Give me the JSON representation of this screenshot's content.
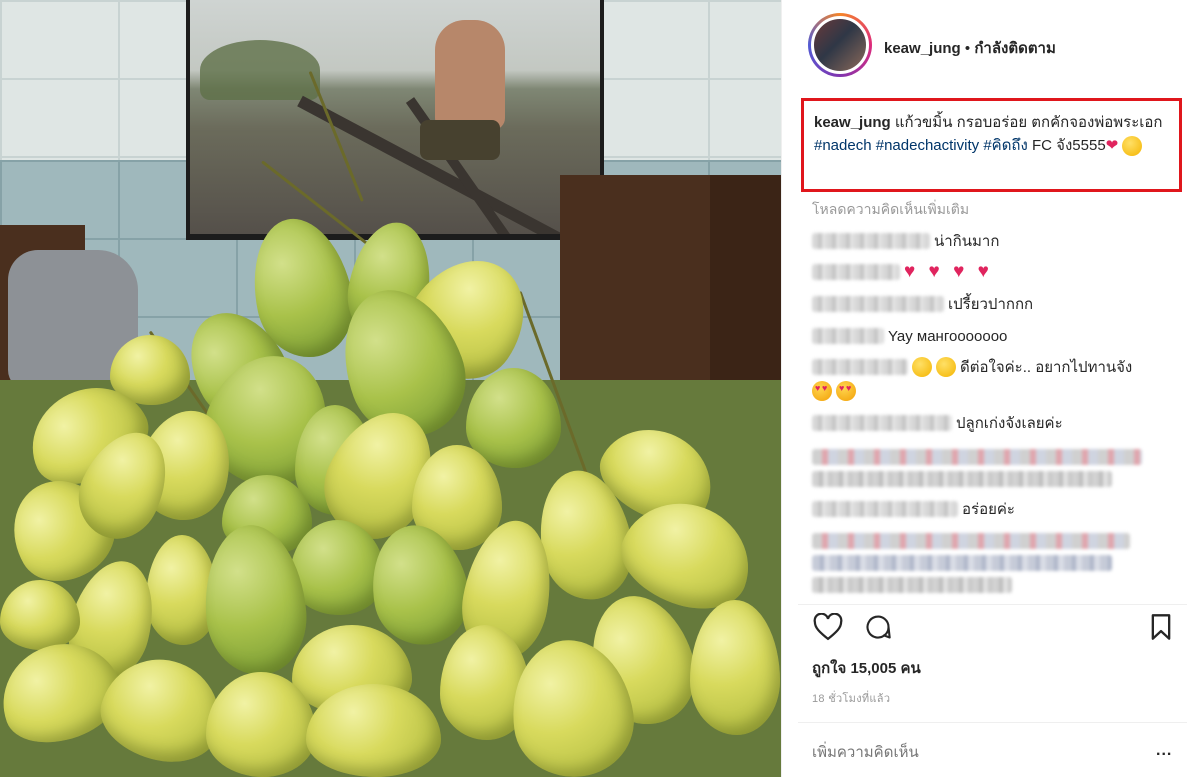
{
  "post": {
    "photo_alt_icon": "mango-photo",
    "header": {
      "username": "keaw_jung",
      "separator": "•",
      "follow_status": "กำลังติดตาม"
    },
    "caption": {
      "username": "keaw_jung",
      "text_1": "แก้วขมิ้น กรอบอร่อย ตกคักจองพ่อพระเอก",
      "hashtag_1": "#nadech",
      "hashtag_2": "#nadechactivity",
      "hashtag_3": "#คิดถึง",
      "text_2": "FC จัง5555",
      "emoji_icons": [
        "red-heart-icon",
        "blushing-face-icon"
      ]
    },
    "load_more_comments": "โหลดความคิดเห็นเพิ่มเติม",
    "comments": [
      {
        "text": "น่ากินมาก"
      },
      {
        "text": "♥ ♥ ♥ ♥"
      },
      {
        "text": "เปรี้ยวปากกก"
      },
      {
        "text": "Yay мангооооооо"
      },
      {
        "text": "ดีต่อใจค่ะ.. อยากไปทานจัง"
      },
      {
        "text": "ปลูกเก่งจังเลยค่ะ"
      },
      {
        "text": "อร่อยค่ะ"
      }
    ],
    "actions": {
      "like_icon": "heart-outline-icon",
      "comment_icon": "comment-bubble-icon",
      "save_icon": "bookmark-icon"
    },
    "likes_text": "ถูกใจ 15,005 คน",
    "timestamp": "18 ชั่วโมงที่แล้ว",
    "add_comment_placeholder": "เพิ่มความคิดเห็น",
    "more_label": "..."
  },
  "colors": {
    "highlight_box": "#e0161c",
    "hashtag": "#003569",
    "muted_text": "#999999",
    "heart": "#e0245e"
  }
}
